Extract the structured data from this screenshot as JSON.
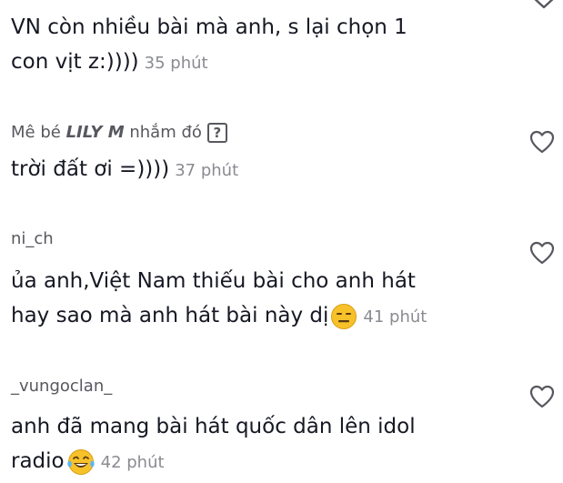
{
  "comments": [
    {
      "text_line1": "VN còn nhiều bài mà anh, s lại chọn 1",
      "text_line2": "con vịt z:))))",
      "time": "35 phút"
    },
    {
      "username_prefix": "Mê bé",
      "username_bold": "LILY M",
      "username_suffix": "nhắm đó",
      "username_icon": "?",
      "text_line1": "trời đất ơi =))))",
      "time": "37 phút"
    },
    {
      "username": "ni_ch",
      "text_line1": "ủa anh,Việt Nam thiếu bài cho anh hát",
      "text_line2": "hay sao mà anh hát bài này dị",
      "emoji": "expressionless-face-icon",
      "time": "41 phút"
    },
    {
      "username": "_vungoclan_",
      "text_line1": "anh đã mang bài hát quốc dân lên idol",
      "text_line2": "radio",
      "emoji": "tears-of-joy-face-icon",
      "time": "42 phút"
    }
  ],
  "colors": {
    "text": "#161823",
    "username": "#57585e",
    "time": "#8a8b91",
    "emoji": "#f7c12a"
  }
}
